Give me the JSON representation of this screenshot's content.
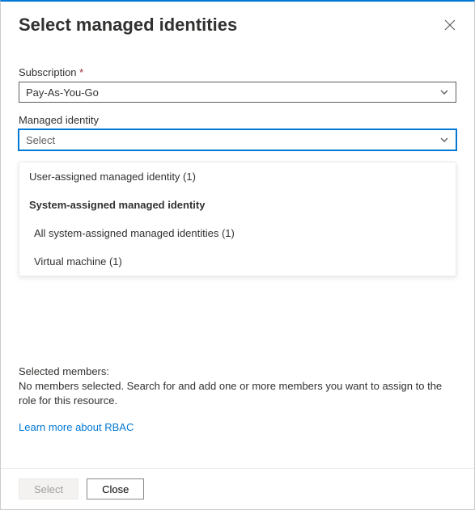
{
  "header": {
    "title": "Select managed identities"
  },
  "subscription": {
    "label": "Subscription",
    "value": "Pay-As-You-Go"
  },
  "managed_identity": {
    "label": "Managed identity",
    "placeholder": "Select",
    "options": {
      "user_assigned": "User-assigned managed identity (1)",
      "system_group": "System-assigned managed identity",
      "all_system": "All system-assigned managed identities (1)",
      "virtual_machine": "Virtual machine (1)"
    }
  },
  "selected": {
    "label": "Selected members:",
    "message": "No members selected. Search for and add one or more members you want to assign to the role for this resource.",
    "learn_link": "Learn more about RBAC"
  },
  "footer": {
    "select": "Select",
    "close": "Close"
  }
}
